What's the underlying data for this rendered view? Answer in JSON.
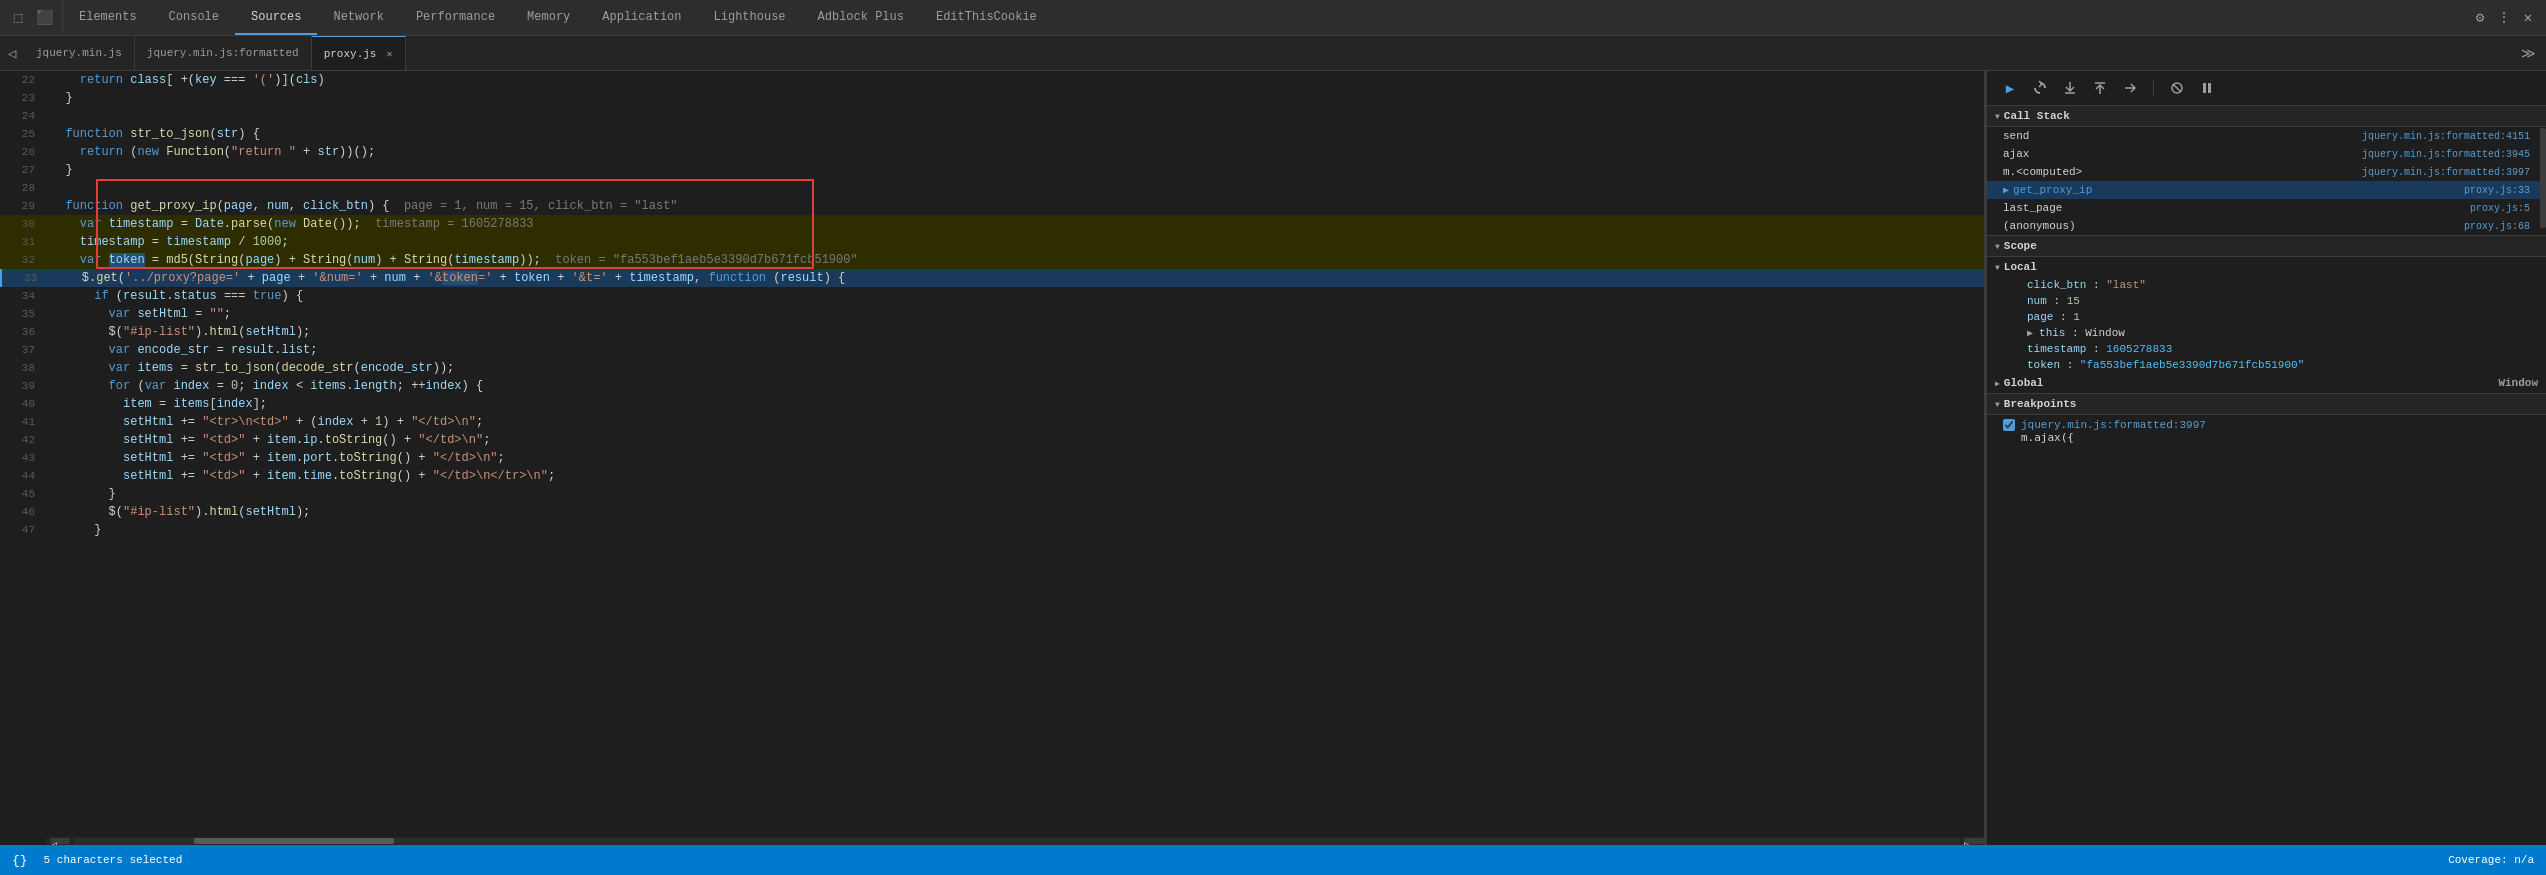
{
  "topbar": {
    "tabs": [
      {
        "label": "Elements",
        "active": false
      },
      {
        "label": "Console",
        "active": false
      },
      {
        "label": "Sources",
        "active": true
      },
      {
        "label": "Network",
        "active": false
      },
      {
        "label": "Performance",
        "active": false
      },
      {
        "label": "Memory",
        "active": false
      },
      {
        "label": "Application",
        "active": false
      },
      {
        "label": "Lighthouse",
        "active": false
      },
      {
        "label": "Adblock Plus",
        "active": false
      },
      {
        "label": "EditThisCookie",
        "active": false
      }
    ]
  },
  "filetabs": [
    {
      "label": "jquery.min.js",
      "active": false,
      "closable": false
    },
    {
      "label": "jquery.min.js:formatted",
      "active": false,
      "closable": false
    },
    {
      "label": "proxy.js",
      "active": true,
      "closable": true
    }
  ],
  "callstack": {
    "title": "Call Stack",
    "items": [
      {
        "name": "send",
        "loc": "jquery.min.js:formatted:4151",
        "current": false
      },
      {
        "name": "ajax",
        "loc": "jquery.min.js:formatted:3945",
        "current": false
      },
      {
        "name": "m.<computed>",
        "loc": "jquery.min.js:formatted:3997",
        "current": false
      },
      {
        "name": "get_proxy_ip",
        "loc": "proxy.js:33",
        "current": true
      },
      {
        "name": "last_page",
        "loc": "proxy.js:5",
        "current": false
      },
      {
        "name": "(anonymous)",
        "loc": "proxy.js:68",
        "current": false
      }
    ]
  },
  "scope": {
    "title": "Scope",
    "local": {
      "label": "Local",
      "items": [
        {
          "key": "click_btn",
          "value": "\"last\"",
          "type": "string"
        },
        {
          "key": "num",
          "value": "15",
          "type": "number"
        },
        {
          "key": "page",
          "value": "1",
          "type": "number"
        },
        {
          "key": "this",
          "value": "Window",
          "type": "object"
        },
        {
          "key": "timestamp",
          "value": "1605278833",
          "type": "number"
        },
        {
          "key": "token",
          "value": "\"fa553bef1aeb5e3390d7b671fcb51900\"",
          "type": "string"
        }
      ]
    },
    "global": {
      "label": "Global",
      "value": "Window"
    }
  },
  "breakpoints": {
    "title": "Breakpoints",
    "items": [
      {
        "loc": "jquery.min.js:formatted:3997",
        "code": "m.ajax({",
        "checked": true
      }
    ]
  },
  "statusbar": {
    "left": "⌥ 5 characters selected",
    "right": "Coverage: n/a"
  },
  "code": {
    "lines": [
      {
        "num": 22,
        "text": "    return class[ +(key === '(')(cls)"
      },
      {
        "num": 23,
        "text": "  }"
      },
      {
        "num": 24,
        "text": ""
      },
      {
        "num": 25,
        "text": "  function str_to_json(str) {"
      },
      {
        "num": 26,
        "text": "    return (new Function(\"return \" + str))();"
      },
      {
        "num": 27,
        "text": "  }"
      },
      {
        "num": 28,
        "text": ""
      },
      {
        "num": 29,
        "text": "  function get_proxy_ip(page, num, click_btn) {  page = 1, num = 15, click_btn = \"last\""
      },
      {
        "num": 30,
        "text": "    var timestamp = Date.parse(new Date());  timestamp = 1605278833"
      },
      {
        "num": 31,
        "text": "    timestamp = timestamp / 1000;"
      },
      {
        "num": 32,
        "text": "    var token = md5(String(page) + String(num) + String(timestamp));  token = \"fa553bef1aeb5e3390d7b671fcb51900\""
      },
      {
        "num": 33,
        "text": "    $.get('../proxy?page=' + page + '&num=' + num + '&token=' + token + '&t=' + timestamp, function (result) {",
        "debug": true
      },
      {
        "num": 34,
        "text": "      if (result.status === true) {"
      },
      {
        "num": 35,
        "text": "        var setHtml = \"\";"
      },
      {
        "num": 36,
        "text": "        $(\"#ip-list\").html(setHtml);"
      },
      {
        "num": 37,
        "text": "        var encode_str = result.list;"
      },
      {
        "num": 38,
        "text": "        var items = str_to_json(decode_str(encode_str));"
      },
      {
        "num": 39,
        "text": "        for (var index = 0; index < items.length; ++index) {"
      },
      {
        "num": 40,
        "text": "          item = items[index];"
      },
      {
        "num": 41,
        "text": "          setHtml += \"<tr>\\n<td>\" + (index + 1) + \"</td>\\n\";"
      },
      {
        "num": 42,
        "text": "          setHtml += \"<td>\" + item.ip.toString() + \"</td>\\n\";"
      },
      {
        "num": 43,
        "text": "          setHtml += \"<td>\" + item.port.toString() + \"</td>\\n\";"
      },
      {
        "num": 44,
        "text": "          setHtml += \"<td>\" + item.time.toString() + \"</td>\\n</tr>\\n\";"
      },
      {
        "num": 45,
        "text": "        }"
      },
      {
        "num": 46,
        "text": "        $(\"#ip-list\").html(setHtml);"
      },
      {
        "num": 47,
        "text": "      }"
      }
    ]
  }
}
